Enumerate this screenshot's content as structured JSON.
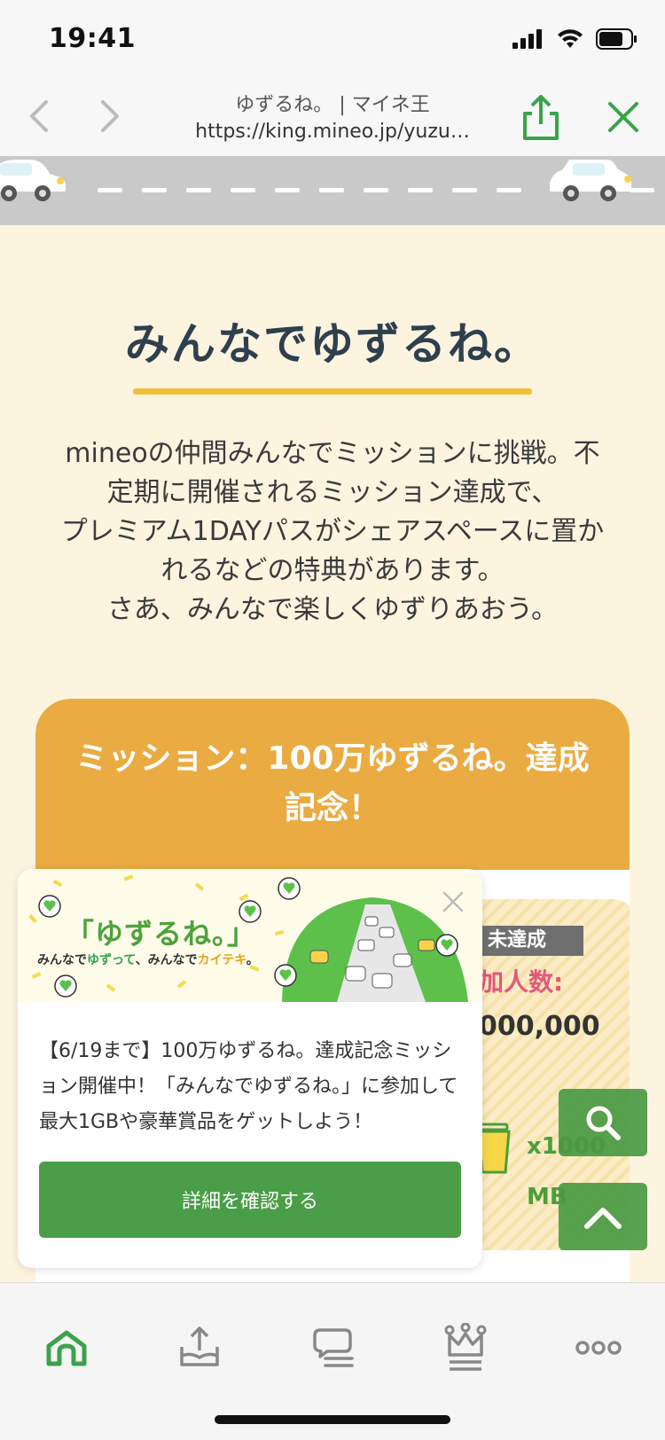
{
  "status": {
    "time": "19:41"
  },
  "browser": {
    "title": "ゆずるね。 | マイネ王",
    "url": "https://king.mineo.jp/yuzu…"
  },
  "main": {
    "title": "みんなでゆずるね。",
    "intro_lines": [
      "mineoの仲間みんなでミッションに挑戦。不",
      "定期に開催されるミッション達成で、",
      "プレミアム1DAYパスがシェアスペースに置か",
      "れるなどの特典があります。",
      "さあ、みんなで楽しくゆずりあおう。"
    ]
  },
  "mission": {
    "title_line1": "ミッション：100万ゆずるね。達成",
    "title_line2": "記念！",
    "status_badge": "未達成",
    "participants_label": "加人数:",
    "participants_value": "000,000",
    "reward_multiplier": "x1000",
    "reward_unit": "MB"
  },
  "popup": {
    "banner_title": "「ゆずるね。」",
    "banner_sub_parts": [
      "みんなで",
      "ゆずって",
      "、みんなで",
      "カイテキ",
      "。"
    ],
    "text": "【6/19まで】100万ゆずるね。達成記念ミッション開催中！「みんなでゆずるね。」に参加して最大1GBや豪華賞品をゲットしよう！",
    "button_label": "詳細を確認する"
  },
  "colors": {
    "accent_green": "#4a9e47",
    "mission_orange": "#eaab42",
    "title_underline": "#f2bf3c",
    "page_bg": "#fdf4e0"
  },
  "icons": {
    "back": "chevron-left-icon",
    "forward": "chevron-right-icon",
    "share": "share-icon",
    "close": "close-icon",
    "search": "search-icon",
    "scroll_top": "chevron-up-icon",
    "tabs": [
      "home-icon",
      "upload-tray-icon",
      "chat-icon",
      "crown-icon",
      "more-icon"
    ]
  }
}
